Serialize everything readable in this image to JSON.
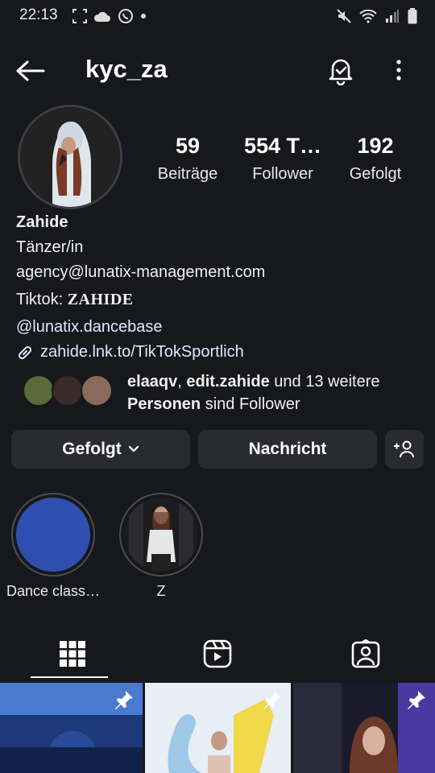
{
  "status_bar": {
    "time": "22:13",
    "icons": [
      "screenshot-icon",
      "cloud-icon",
      "whatsapp-icon",
      "dot-icon",
      "mute-icon",
      "wifi-icon",
      "signal-icon",
      "battery-icon"
    ]
  },
  "header": {
    "username": "kyc_za",
    "icons": [
      "back-arrow-icon",
      "notification-bell-icon",
      "more-icon"
    ]
  },
  "stats": [
    {
      "value": "59",
      "label": "Beiträge"
    },
    {
      "value": "554 T…",
      "label": "Follower"
    },
    {
      "value": "192",
      "label": "Gefolgt"
    }
  ],
  "bio": {
    "name": "Zahide",
    "category": "Tänzer/in",
    "email": "agency@lunatix-management.com",
    "tiktok_prefix": "Tiktok: ",
    "tiktok_name": "ZAHIDE",
    "mention": "@lunatix.dancebase",
    "link": "zahide.lnk.to/TikTokSportlich"
  },
  "followed_by": {
    "user1": "elaaqv",
    "separator": ", ",
    "user2": "edit.zahide",
    "middle": " und 13 weitere ",
    "bold_end": "Personen",
    "end": " sind Follower"
  },
  "buttons": {
    "following": "Gefolgt",
    "message": "Nachricht"
  },
  "highlights": [
    {
      "label": "Dance class…"
    },
    {
      "label": "Z"
    }
  ],
  "colors": {
    "background": "#17181b",
    "button": "#2a2b30",
    "highlight_blue": "#2f4fb0"
  }
}
